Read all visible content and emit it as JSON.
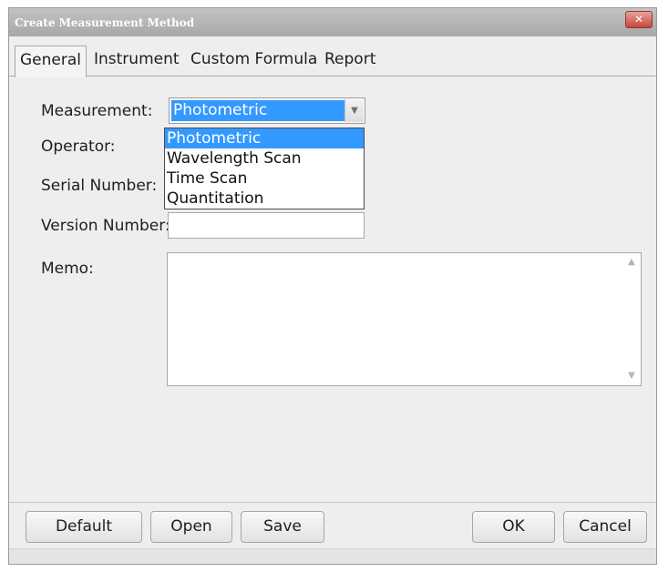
{
  "window": {
    "title": "Create Measurement Method",
    "close_glyph": "✕"
  },
  "tabs": [
    {
      "label": "General",
      "active": true
    },
    {
      "label": "Instrument",
      "active": false
    },
    {
      "label": "Custom Formula",
      "active": false
    },
    {
      "label": "Report",
      "active": false
    }
  ],
  "form": {
    "measurement_label": "Measurement:",
    "measurement_value": "Photometric",
    "measurement_options": [
      "Photometric",
      "Wavelength Scan",
      "Time Scan",
      "Quantitation"
    ],
    "operator_label": "Operator:",
    "serial_label": "Serial Number:",
    "version_label": "Version Number:",
    "version_value": "",
    "memo_label": "Memo:",
    "memo_value": ""
  },
  "buttons": {
    "default": "Default",
    "open": "Open",
    "save": "Save",
    "ok": "OK",
    "cancel": "Cancel"
  },
  "icons": {
    "combo_arrow": "chevron-down-icon",
    "scroll_up": "scroll-up-icon",
    "scroll_down": "scroll-down-icon",
    "close": "close-icon"
  },
  "colors": {
    "selection": "#3399ff",
    "close_button": "#c8463a"
  }
}
